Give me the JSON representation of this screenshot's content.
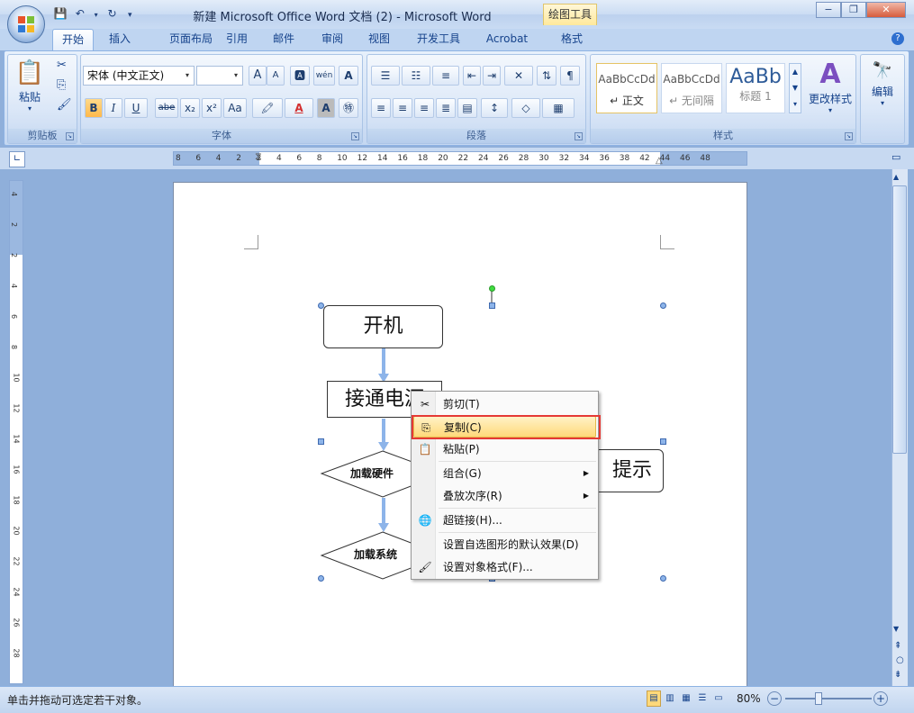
{
  "title_bar": {
    "doc_title": "新建 Microsoft Office Word 文档 (2) - Microsoft Word",
    "tool_tab": "绘图工具",
    "minimize": "−",
    "restore": "❐",
    "close": "✕"
  },
  "tabs": [
    "开始",
    "插入",
    "页面布局",
    "引用",
    "邮件",
    "审阅",
    "视图",
    "开发工具",
    "Acrobat",
    "格式"
  ],
  "ribbon": {
    "clipboard": {
      "label": "剪贴板",
      "paste": "粘贴"
    },
    "font": {
      "label": "字体",
      "font_name": "宋体 (中文正文)",
      "font_size": "",
      "bold": "B",
      "italic": "I",
      "underline": "U",
      "strike": "abe",
      "sub": "x₂",
      "sup": "x²",
      "case": "Aa",
      "grow": "A",
      "shrink": "A",
      "clear": "A",
      "wen": "wén",
      "charborder": "A"
    },
    "paragraph": {
      "label": "段落"
    },
    "styles": {
      "label": "样式",
      "items": [
        {
          "preview": "AaBbCcDd",
          "name": "↵ 正文"
        },
        {
          "preview": "AaBbCcDd",
          "name": "↵ 无间隔"
        },
        {
          "preview": "AaBb",
          "name": "标题 1"
        }
      ],
      "change": "更改样式"
    },
    "editing": {
      "label": "编辑"
    }
  },
  "ruler": {
    "h_ticks": [
      "8",
      "6",
      "4",
      "2",
      "2",
      "4",
      "6",
      "8",
      "10",
      "12",
      "14",
      "16",
      "18",
      "20",
      "22",
      "24",
      "26",
      "28",
      "30",
      "32",
      "34",
      "36",
      "38",
      "42",
      "44",
      "46",
      "48"
    ],
    "v_ticks": [
      "4",
      "2",
      "2",
      "4",
      "6",
      "8",
      "10",
      "12",
      "14",
      "16",
      "18",
      "20",
      "22",
      "24",
      "26",
      "28"
    ]
  },
  "flowchart": {
    "n1": "开机",
    "n2": "接通电源",
    "n3": "加载硬件",
    "n4": "加载系统",
    "n5": "提示"
  },
  "context_menu": [
    {
      "label": "剪切(T)",
      "icon": "scissors-icon",
      "glyph": "✂"
    },
    {
      "label": "复制(C)",
      "icon": "copy-icon",
      "glyph": "⎘",
      "highlighted": true
    },
    {
      "label": "粘贴(P)",
      "icon": "paste-icon",
      "glyph": "📋"
    },
    {
      "label": "组合(G)",
      "submenu": true
    },
    {
      "label": "叠放次序(R)",
      "submenu": true
    },
    {
      "label": "超链接(H)...",
      "icon": "hyperlink-icon",
      "glyph": "🌐"
    },
    {
      "label": "设置自选图形的默认效果(D)"
    },
    {
      "label": "设置对象格式(F)...",
      "icon": "format-icon",
      "glyph": "🖌"
    }
  ],
  "status_bar": {
    "message": "单击并拖动可选定若干对象。",
    "zoom": "80%",
    "zoom_level": 0.8
  }
}
